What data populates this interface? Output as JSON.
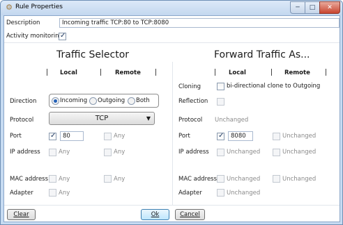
{
  "window": {
    "title": "Rule Properties",
    "minimize_glyph": "─",
    "maximize_glyph": "□",
    "close_glyph": "✕",
    "icon": "gear-icon"
  },
  "description": {
    "label": "Description",
    "value": "Incoming traffic TCP:80 to TCP:8080"
  },
  "activity_monitoring": {
    "label": "Activity monitoring",
    "checked": true
  },
  "traffic_selector": {
    "title": "Traffic Selector",
    "col_local": "Local",
    "col_remote": "Remote",
    "direction": {
      "label": "Direction",
      "options": [
        "Incoming",
        "Outgoing",
        "Both"
      ],
      "selected": "Incoming"
    },
    "protocol": {
      "label": "Protocol",
      "value": "TCP",
      "arrow": "▼"
    },
    "port": {
      "label": "Port",
      "local_checked": true,
      "local_value": "80",
      "remote_label": "Any"
    },
    "ip_address": {
      "label": "IP address",
      "local_label": "Any",
      "remote_label": "Any"
    },
    "mac_address": {
      "label": "MAC address",
      "local_label": "Any",
      "remote_label": "Any"
    },
    "adapter": {
      "label": "Adapter",
      "local_label": "Any"
    }
  },
  "forward_traffic": {
    "title": "Forward Traffic As...",
    "col_local": "Local",
    "col_remote": "Remote",
    "cloning": {
      "label": "Cloning",
      "option_label": "bi-directional clone to Outgoing"
    },
    "reflection": {
      "label": "Reflection"
    },
    "protocol": {
      "label": "Protocol",
      "value": "Unchanged"
    },
    "port": {
      "label": "Port",
      "local_checked": true,
      "local_value": "8080",
      "remote_label": "Unchanged"
    },
    "ip_address": {
      "label": "IP address",
      "local_label": "Unchanged",
      "remote_label": "Unchanged"
    },
    "mac_address": {
      "label": "MAC address",
      "local_label": "Unchanged",
      "remote_label": "Unchanged"
    },
    "adapter": {
      "label": "Adapter",
      "local_label": "Unchanged"
    }
  },
  "buttons": {
    "clear": "Clear",
    "ok": "Ok",
    "cancel": "Cancel"
  },
  "colors": {
    "title_bar": "#c7dbf2",
    "close_button": "#c8452f",
    "radio_selected": "#2461b8",
    "ok_button": "#bee6fd"
  }
}
